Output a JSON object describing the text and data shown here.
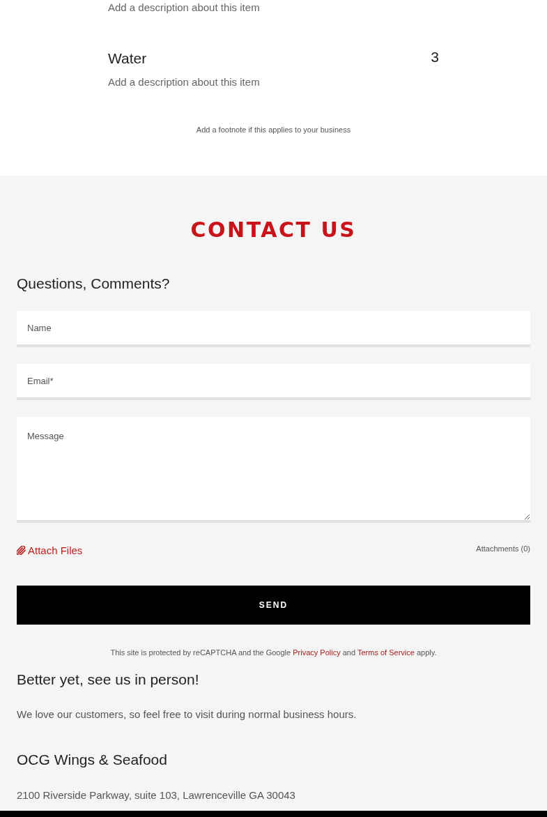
{
  "menu": {
    "items": [
      {
        "description": "Add a description about this item"
      },
      {
        "name": "Water",
        "price": "3",
        "description": "Add a description about this item"
      }
    ],
    "footnote": "Add a footnote if this applies to your business"
  },
  "contact": {
    "title": "CONTACT US",
    "heading": "Questions, Comments?",
    "fields": [
      {
        "kind": "input",
        "placeholder": "Name"
      },
      {
        "kind": "input",
        "placeholder": "Email*"
      },
      {
        "kind": "textarea",
        "placeholder": "Message"
      }
    ],
    "attach_label": "Attach Files",
    "attachments": "Attachments (0)",
    "submit": "SEND",
    "recaptcha_notice": [
      {
        "kind": "text",
        "text": "This site is protected by reCAPTCHA and the Google"
      },
      {
        "kind": "link",
        "text": "Privacy Policy"
      },
      {
        "kind": "text",
        "text": "and"
      },
      {
        "kind": "link",
        "text": "Terms of Service"
      },
      {
        "kind": "text",
        "text": "apply."
      }
    ]
  },
  "visit": {
    "heading": "Better yet, see us in person!",
    "text": "We love our customers, so feel free to visit during normal business hours.",
    "business_name": "OCG Wings & Seafood",
    "address": "2100 Riverside Parkway, suite 103, Lawrenceville GA 30043"
  }
}
